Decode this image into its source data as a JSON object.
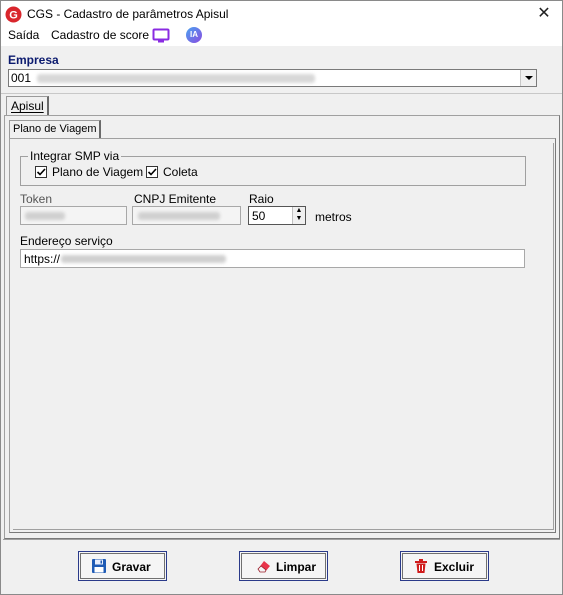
{
  "window": {
    "title": "CGS - Cadastro de parâmetros Apisul",
    "close_glyph": "✕"
  },
  "menu": {
    "saida": "Saída",
    "cadastro_score": "Cadastro de score",
    "ia_badge": "IA",
    "monitor_icon": "monitor-icon"
  },
  "empresa": {
    "label": "Empresa",
    "value_prefix": "001"
  },
  "tabs": {
    "outer": "Apisul",
    "inner": "Plano de Viagem"
  },
  "integrar": {
    "legend": "Integrar SMP via",
    "plano_label": "Plano de Viagem",
    "plano_checked": true,
    "coleta_label": "Coleta",
    "coleta_checked": true
  },
  "fields": {
    "token_label": "Token",
    "cnpj_label": "CNPJ Emitente",
    "raio_label": "Raio",
    "raio_value": "50",
    "metros_label": "metros",
    "endereco_label": "Endereço serviço",
    "endereco_prefix": "https://"
  },
  "buttons": {
    "gravar": "Gravar",
    "limpar": "Limpar",
    "excluir": "Excluir"
  },
  "colors": {
    "empresa_label": "#0b1a6e",
    "button_border": "#2a3a8a",
    "logo_red": "#d9262c",
    "ia_purple": "#7b5bd6"
  }
}
